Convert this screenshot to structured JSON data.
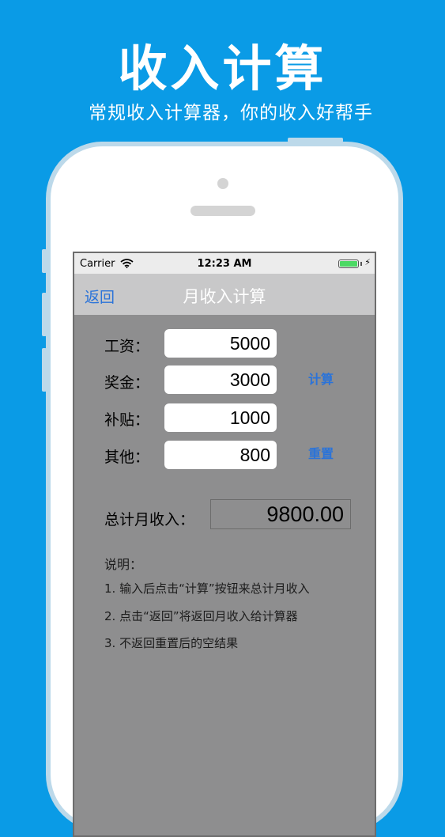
{
  "promo": {
    "title": "收入计算",
    "subtitle": "常规收入计算器，你的收入好帮手"
  },
  "status_bar": {
    "carrier": "Carrier",
    "time": "12:23 AM",
    "bolt": "⚡"
  },
  "nav": {
    "back": "返回",
    "title": "月收入计算"
  },
  "form": {
    "fields": [
      {
        "label": "工资：",
        "value": "5000"
      },
      {
        "label": "奖金：",
        "value": "3000"
      },
      {
        "label": "补贴：",
        "value": "1000"
      },
      {
        "label": "其他：",
        "value": "800"
      }
    ],
    "calculate_label": "计算",
    "reset_label": "重置",
    "total_label": "总计月收入：",
    "total_value": "9800.00"
  },
  "notes": {
    "heading": "说明：",
    "lines": [
      "1. 输入后点击“计算”按钮来总计月收入",
      "2. 点击“返回”将返回月收入给计算器",
      "3. 不返回重置后的空结果"
    ]
  },
  "colors": {
    "background": "#0a9be6",
    "accent": "#2a73d9",
    "screen": "#8e8e8f",
    "battery": "#4cd964"
  }
}
